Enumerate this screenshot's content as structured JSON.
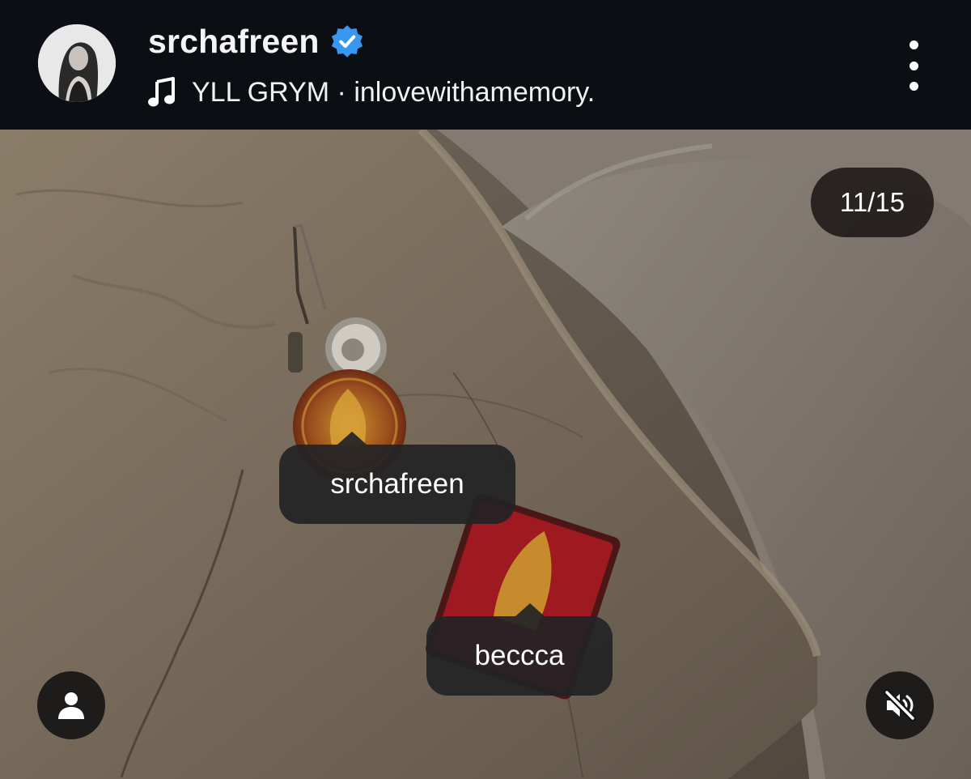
{
  "header": {
    "username": "srchafreen",
    "verified": true,
    "audio_artist": "YLL GRYM",
    "audio_separator": "·",
    "audio_track": "inlovewithamemory.",
    "more_icon": "more-vertical-icon"
  },
  "media": {
    "counter": "11/15",
    "tags": [
      {
        "label": "srchafreen"
      },
      {
        "label": "beccca"
      }
    ],
    "tags_icon": "person-icon",
    "mute_icon": "speaker-muted-icon"
  },
  "colors": {
    "background": "#0b0f14",
    "verified_badge": "#3897f0",
    "tag_bubble": "#242426"
  }
}
